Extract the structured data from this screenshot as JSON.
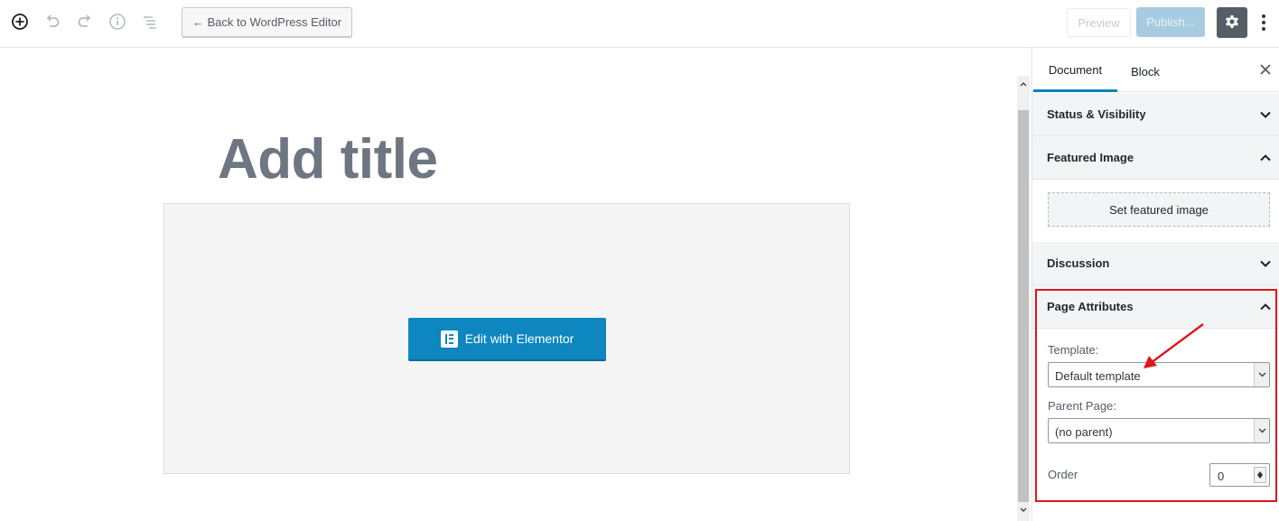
{
  "toolbar": {
    "back_label": "← Back to WordPress Editor",
    "preview_label": "Preview",
    "publish_label": "Publish...",
    "icons": [
      "add-block-icon",
      "undo-icon",
      "redo-icon",
      "info-icon",
      "outline-icon",
      "gear-icon",
      "more-icon"
    ]
  },
  "editor": {
    "title_placeholder": "Add title",
    "elementor_button": "Edit with Elementor"
  },
  "sidebar": {
    "tabs": [
      {
        "label": "Document",
        "active": true
      },
      {
        "label": "Block",
        "active": false
      }
    ],
    "panels": {
      "status": "Status & Visibility",
      "featured": "Featured Image",
      "featured_button": "Set featured image",
      "discussion": "Discussion",
      "page_attributes": "Page Attributes"
    },
    "page_attributes": {
      "template_label": "Template:",
      "template_value": "Default template",
      "parent_label": "Parent Page:",
      "parent_value": "(no parent)",
      "order_label": "Order",
      "order_value": "0"
    }
  },
  "colors": {
    "accent": "#0085ba",
    "elementor": "#0e86bf",
    "highlight": "#e0161b"
  }
}
